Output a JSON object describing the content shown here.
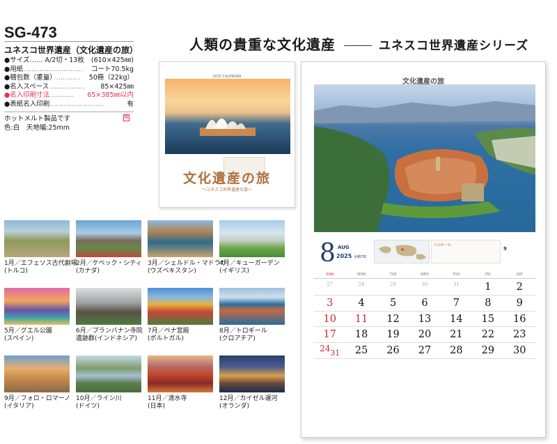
{
  "header": {
    "title": "人類の貴重な文化遺産",
    "subtitle": "ユネスコ世界遺産シリーズ"
  },
  "spec": {
    "code": "SG-473",
    "name": "ユネスコ世界遺産（文化遺産の旅）",
    "items": [
      {
        "key": "●サイズ…… A/2切・13枚",
        "dots": "",
        "value": "(610×425㎜)"
      },
      {
        "key": "●用紙",
        "dots": "…………………………",
        "value": "コート70.5kg"
      },
      {
        "key": "●梱包数（重量）",
        "dots": "…………",
        "value": "50冊（22kg）"
      },
      {
        "key": "●名入スペース",
        "dots": "………………",
        "value": "85×425㎜"
      },
      {
        "key": "●名入印刷寸法",
        "dots": "…………",
        "value": "65×385㎜以内"
      },
      {
        "key": "●表紙名入印刷",
        "dots": "………………………",
        "value": "有"
      }
    ],
    "note_line1": "ホットメルト製品です",
    "note_line2": "色:白　天地幅:25mm",
    "hot_badge": "糊"
  },
  "cover": {
    "cal_label": "2025 CALENDAR",
    "title": "文化遺産の旅",
    "subtitle": "〜ユネスコ世界遺産の旅〜"
  },
  "thumbnails": [
    {
      "line1": "1月／エフェソス古代劇場",
      "line2": "(トルコ)"
    },
    {
      "line1": "2月／ケベック・シティ",
      "line2": "(カナダ)"
    },
    {
      "line1": "3月／シェルドル・マドラサ",
      "line2": "(ウズベキスタン)"
    },
    {
      "line1": "4月／キューガーデン",
      "line2": "(イギリス)"
    },
    {
      "line1": "5月／グエル公園",
      "line2": "(スペイン)"
    },
    {
      "line1": "6月／プランバナン寺院",
      "line2": "遺跡群(インドネシア)"
    },
    {
      "line1": "7月／ペナ宮殿",
      "line2": "(ポルトガル)"
    },
    {
      "line1": "8月／トロギール",
      "line2": "(クロアチア)"
    },
    {
      "line1": "9月／フォロ・ロマーノ",
      "line2": "(イタリア)"
    },
    {
      "line1": "10月／ライン川",
      "line2": "(ドイツ)"
    },
    {
      "line1": "11月／清水寺",
      "line2": "(日本)"
    },
    {
      "line1": "12月／カイゼル運河",
      "line2": "(オランダ)"
    }
  ],
  "wall": {
    "title": "文化遺産の旅",
    "month_number": "8",
    "month_abbr": "AUG",
    "year": "2025",
    "era": "令和7年",
    "info_title": "トロギール",
    "mini_month": "9",
    "weekdays": [
      "SUN",
      "MON",
      "TUE",
      "WED",
      "THU",
      "FRI",
      "SAT"
    ],
    "weeks": [
      [
        "27",
        "28",
        "29",
        "30",
        "31",
        "1",
        "2"
      ],
      [
        "3",
        "4",
        "5",
        "6",
        "7",
        "8",
        "9"
      ],
      [
        "10",
        "11",
        "12",
        "13",
        "14",
        "15",
        "16"
      ],
      [
        "17",
        "18",
        "19",
        "20",
        "21",
        "22",
        "23"
      ],
      [
        "24",
        "25",
        "26",
        "27",
        "28",
        "29",
        "30"
      ]
    ],
    "extra_day": "31"
  },
  "colors": {
    "accent_red": "#d0242e",
    "navy": "#1f3d6e",
    "cover_brown": "#b0703c",
    "spec_red": "#e8344a"
  }
}
